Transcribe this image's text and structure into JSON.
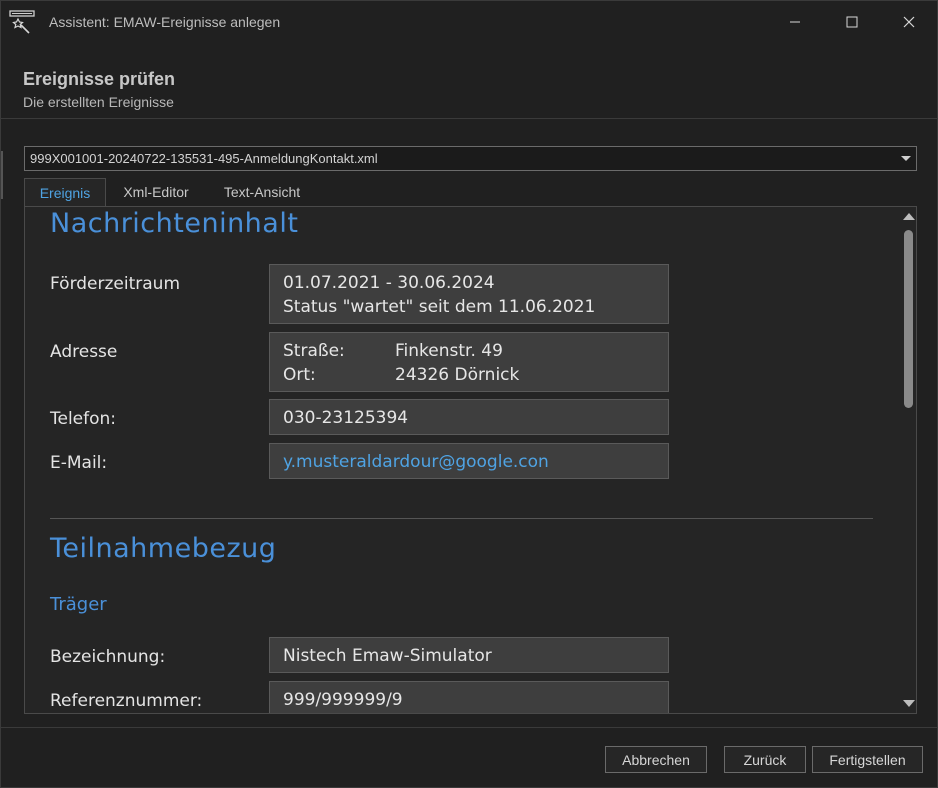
{
  "window": {
    "title": "Assistent: EMAW-Ereignisse anlegen",
    "icon": "wizard-wand-icon"
  },
  "header": {
    "title": "Ereignisse prüfen",
    "subtitle": "Die erstellten Ereignisse"
  },
  "file_select": {
    "value": "999X001001-20240722-135531-495-AnmeldungKontakt.xml"
  },
  "tabs": [
    {
      "label": "Ereignis",
      "active": true
    },
    {
      "label": "Xml-Editor",
      "active": false
    },
    {
      "label": "Text-Ansicht",
      "active": false
    }
  ],
  "content": {
    "section1": {
      "title": "Nachrichteninhalt",
      "foerderzeitraum": {
        "label": "Förderzeitraum",
        "line1": "01.07.2021 - 30.06.2024",
        "line2": "Status \"wartet\" seit dem 11.06.2021"
      },
      "adresse": {
        "label": "Adresse",
        "strasse_label": "Straße:",
        "strasse_value": "Finkenstr. 49",
        "ort_label": "Ort:",
        "ort_value": "24326 Dörnick"
      },
      "telefon": {
        "label": "Telefon:",
        "value": "030-23125394"
      },
      "email": {
        "label": "E-Mail:",
        "value": "y.musteraldardour@google.con"
      }
    },
    "section2": {
      "title": "Teilnahmebezug",
      "subtitle": "Träger",
      "bezeichnung": {
        "label": "Bezeichnung:",
        "value": "Nistech Emaw-Simulator"
      },
      "referenznummer": {
        "label": "Referenznummer:",
        "value": "999/999999/9"
      }
    }
  },
  "footer": {
    "cancel": "Abbrechen",
    "back": "Zurück",
    "finish": "Fertigstellen"
  },
  "colors": {
    "accent": "#4a90d9",
    "link": "#4fa3e3",
    "background": "#202020",
    "field_bg": "#3e3e3e"
  }
}
